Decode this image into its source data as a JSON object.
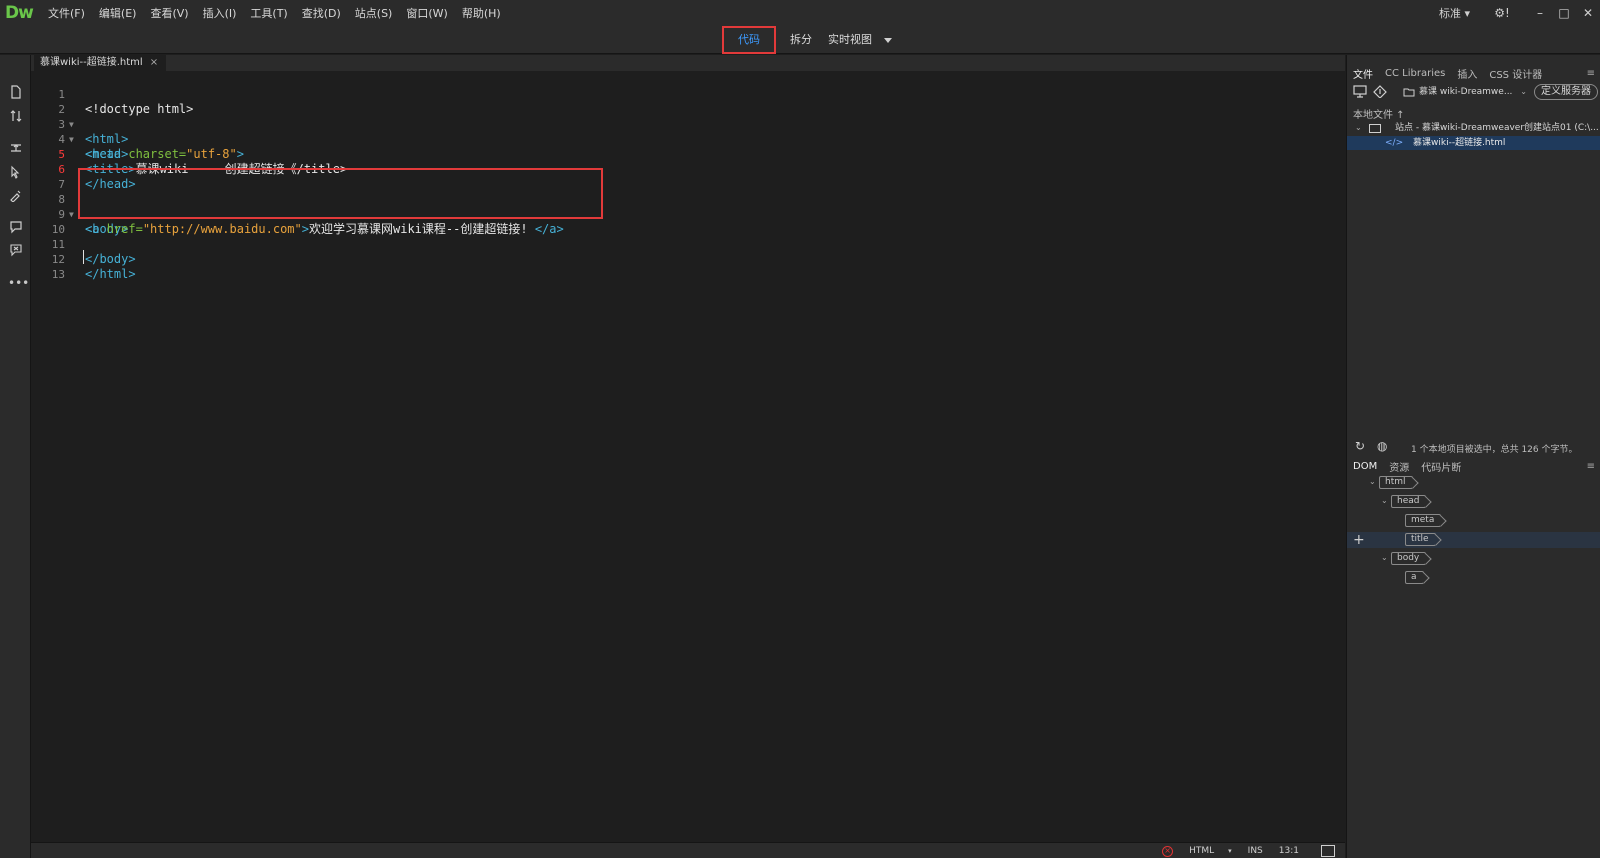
{
  "app": {
    "logo": "Dw",
    "menu": [
      "文件(F)",
      "编辑(E)",
      "查看(V)",
      "插入(I)",
      "工具(T)",
      "查找(D)",
      "站点(S)",
      "窗口(W)",
      "帮助(H)"
    ],
    "workspace": "标准 ▾",
    "settings_glyph": "⚙!",
    "window_controls": [
      "–",
      "□",
      "✕"
    ]
  },
  "view_switcher": {
    "code": "代码",
    "split": "拆分",
    "live": "实时视图",
    "active": "code"
  },
  "document": {
    "tab_title": "慕课wiki--超链接.html",
    "tab_close": "×"
  },
  "editor": {
    "line_numbers": [
      "1",
      "2",
      "3",
      "4",
      "5",
      "6",
      "7",
      "8",
      "9",
      "10",
      "11",
      "12",
      "13"
    ],
    "error_lines": [
      "5",
      "6"
    ],
    "lines": [
      {
        "text": "<!doctype html>"
      },
      {
        "tag": "<html>"
      },
      {
        "tag": "<head>"
      },
      {
        "tag_open": "<meta ",
        "attr": "charset=",
        "str": "\"utf-8\"",
        "tag_close": ">"
      },
      {
        "tag_open": "<title>",
        "txt": "慕课wiki --- 创建超链接《/title>"
      },
      {
        "tag": "</head>"
      },
      {
        "text": ""
      },
      {
        "tag": "<body>"
      },
      {
        "tag_open": "<a ",
        "attr": "href=",
        "str": "\"http://www.baidu.com\"",
        "tag_close": ">",
        "txt": "欢迎学习慕课网wiki课程--创建超链接! ",
        "tag_end": "</a>"
      },
      {
        "text": ""
      },
      {
        "tag": "</body>"
      },
      {
        "tag": "</html>"
      },
      {
        "text": ""
      }
    ]
  },
  "status_bar": {
    "language": "HTML",
    "mode": "INS",
    "position": "13:1"
  },
  "files_panel": {
    "tabs": [
      "文件",
      "CC Libraries",
      "插入",
      "CSS 设计器"
    ],
    "active_tab": "文件",
    "site_select": "慕课 wiki-Dreamwe...",
    "define_server": "定义服务器",
    "local_files_label": "本地文件 ↑",
    "site_label": "站点 - 慕课wiki-Dreamweaver创建站点01 (C:\\...",
    "file_label": "慕课wiki--超链接.html",
    "status_text": "1 个本地项目被选中，总共 126 个字节。"
  },
  "dom_panel": {
    "tabs": [
      "DOM",
      "资源",
      "代码片断"
    ],
    "active_tab": "DOM",
    "nodes": [
      "html",
      "head",
      "meta",
      "title",
      "body",
      "a"
    ],
    "selected_node": "title"
  },
  "colors": {
    "accent_blue": "#3d9bff",
    "highlight_red": "#e23a3a",
    "tag_color": "#46b1d6",
    "attr_color": "#7fbf3f",
    "string_color": "#e8a23c",
    "logo_green": "#6ac64a"
  }
}
